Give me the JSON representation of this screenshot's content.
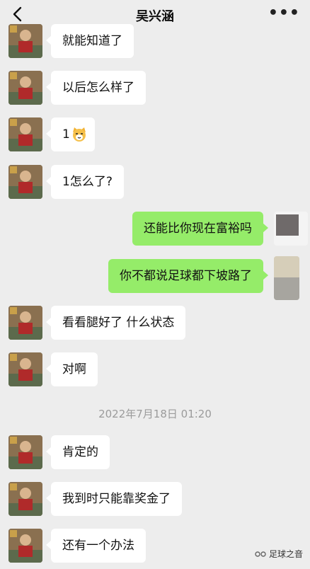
{
  "header": {
    "title": "吴兴涵",
    "back_icon": "chevron-left-icon",
    "more_icon": "ellipsis-icon"
  },
  "messages": [
    {
      "side": "in",
      "text": "就能知道了"
    },
    {
      "side": "in",
      "text": "以后怎么样了"
    },
    {
      "side": "in",
      "text": "1",
      "emoji": "cat-face-emoji"
    },
    {
      "side": "in",
      "text": "1怎么了?"
    },
    {
      "side": "out",
      "text": "还能比你现在富裕吗"
    },
    {
      "side": "out",
      "text": "你不都说足球都下坡路了"
    },
    {
      "side": "in",
      "text": "看看腿好了 什么状态"
    },
    {
      "side": "in",
      "text": "对啊"
    },
    {
      "side": "in",
      "text": "肯定的"
    },
    {
      "side": "in",
      "text": "我到时只能靠奖金了"
    },
    {
      "side": "in",
      "text": "还有一个办法"
    }
  ],
  "timestamp": "2022年7月18日 01:20",
  "watermark": {
    "text": "足球之音",
    "icon": "wechat-channel-icon"
  },
  "colors": {
    "background": "#ededed",
    "incoming_bubble": "#ffffff",
    "outgoing_bubble": "#95ec69"
  }
}
